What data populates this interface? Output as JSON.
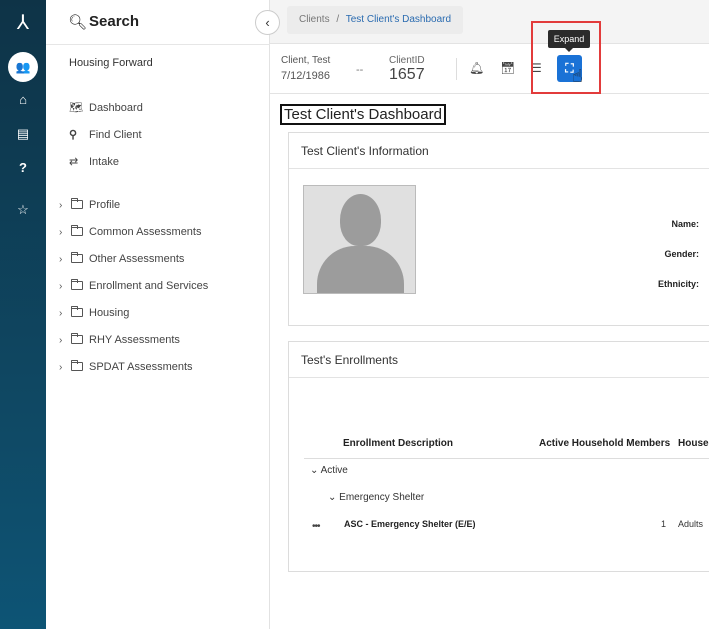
{
  "sidebar": {
    "search_label": "Search",
    "org": "Housing Forward",
    "nav": [
      {
        "label": "Dashboard",
        "icon": "map-icon"
      },
      {
        "label": "Find Client",
        "icon": "search-icon"
      },
      {
        "label": "Intake",
        "icon": "exchange-icon"
      }
    ],
    "folders": [
      "Profile",
      "Common Assessments",
      "Other Assessments",
      "Enrollment and Services",
      "Housing",
      "RHY Assessments",
      "SPDAT Assessments"
    ]
  },
  "breadcrumb": {
    "root": "Clients",
    "separator": "/",
    "current": "Test Client's Dashboard"
  },
  "client": {
    "name": "Client, Test",
    "dob": "7/12/1986",
    "dash": "--",
    "id_label": "ClientID",
    "id_value": "1657"
  },
  "toolbar": {
    "expand_tooltip": "Expand"
  },
  "page_title": "Test Client's Dashboard",
  "info_card": {
    "title": "Test Client's Information",
    "fields": [
      "Name:",
      "Gender:",
      "Ethnicity:"
    ]
  },
  "enrollments": {
    "title": "Test's Enrollments",
    "columns": [
      "Enrollment Description",
      "Active Household Members",
      "Househ"
    ],
    "group_active": "Active",
    "group_program": "Emergency Shelter",
    "rows": [
      {
        "menu": "•••",
        "description": "ASC - Emergency Shelter (E/E)",
        "members": "1",
        "household": "Adults"
      }
    ]
  },
  "colors": {
    "rail": "#0e3347",
    "accent": "#1a72d6",
    "highlight": "#e23b3b",
    "link": "#2a6bb0"
  }
}
